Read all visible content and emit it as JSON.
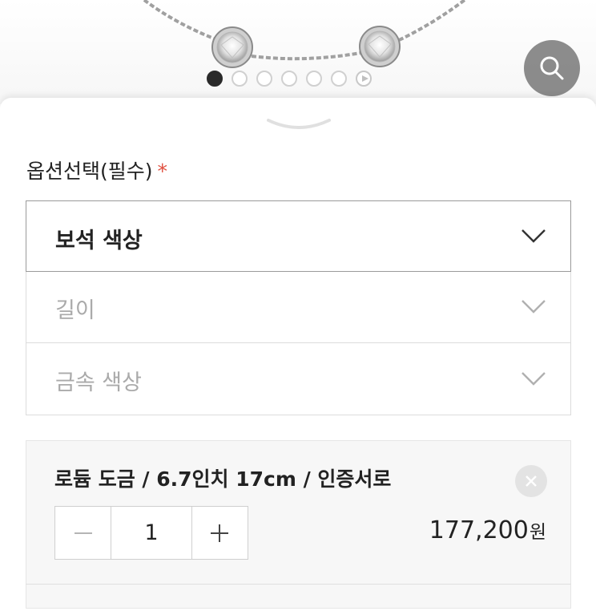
{
  "gallery": {
    "slide_count": 7,
    "active_index": 0
  },
  "option_section": {
    "title": "옵션선택(필수)",
    "required_mark": "*",
    "required_color": "#e05040"
  },
  "selects": [
    {
      "label": "보석 색상",
      "state": "active"
    },
    {
      "label": "길이",
      "state": "disabled"
    },
    {
      "label": "금속 색상",
      "state": "disabled"
    }
  ],
  "selected_item": {
    "name": "로듐 도금 / 6.7인치 17cm / 인증서로",
    "quantity": "1",
    "price": "177,200",
    "currency": "원"
  },
  "icons": {
    "search": "search-icon",
    "chevron": "chevron-down-icon",
    "remove": "close-icon",
    "minus": "minus-icon",
    "plus": "plus-icon"
  }
}
